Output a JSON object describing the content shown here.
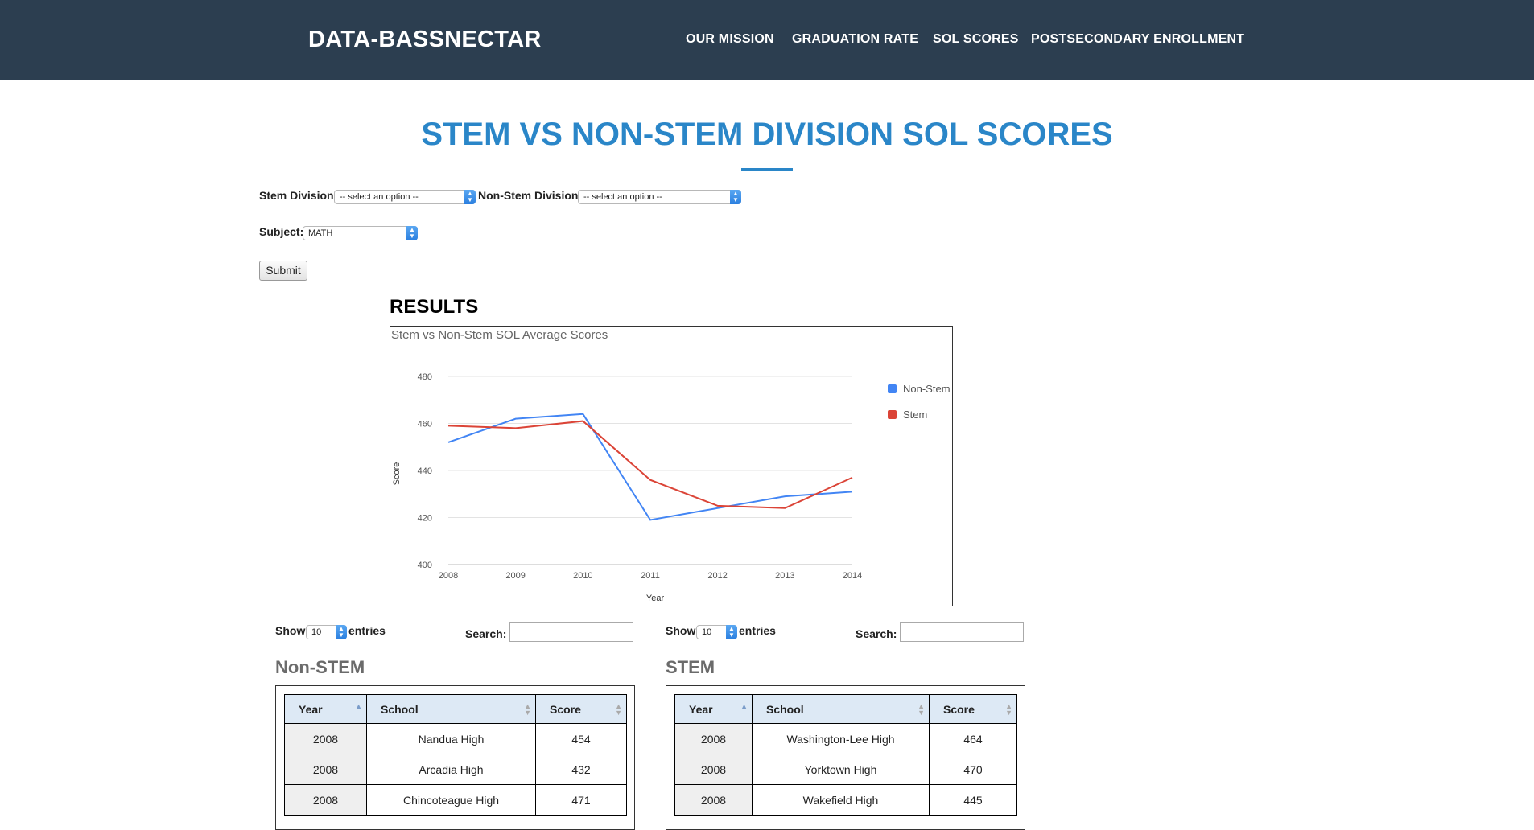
{
  "header": {
    "brand": "DATA-BASSNECTAR",
    "nav": [
      "OUR MISSION",
      "GRADUATION RATE",
      "SOL SCORES",
      "POSTSECONDARY ENROLLMENT"
    ]
  },
  "page_title": "STEM VS NON-STEM DIVISION SOL SCORES",
  "form": {
    "stem_label": "Stem Division:",
    "stem_value": "-- select an option --",
    "nonstem_label": "Non-Stem Division:",
    "nonstem_value": "-- select an option --",
    "subject_label": "Subject:",
    "subject_value": "MATH",
    "submit_label": "Submit"
  },
  "results_heading": "RESULTS",
  "chart_data": {
    "type": "line",
    "title": "Stem vs Non-Stem SOL Average Scores",
    "xlabel": "Year",
    "ylabel": "Score",
    "x": [
      2008,
      2009,
      2010,
      2011,
      2012,
      2013,
      2014
    ],
    "ylim": [
      400,
      480
    ],
    "yticks": [
      400,
      420,
      440,
      460,
      480
    ],
    "grid": true,
    "legend_position": "right",
    "series": [
      {
        "name": "Non-Stem",
        "color": "#4285f4",
        "values": [
          452,
          462,
          464,
          419,
          424,
          429,
          431
        ]
      },
      {
        "name": "Stem",
        "color": "#db4437",
        "values": [
          459,
          458,
          461,
          436,
          425,
          424,
          437
        ]
      }
    ]
  },
  "nonstem_table": {
    "show_label": "Show",
    "entries_value": "10",
    "entries_label": "entries",
    "search_label": "Search:",
    "title": "Non-STEM",
    "columns": [
      "Year",
      "School",
      "Score"
    ],
    "rows": [
      [
        "2008",
        "Nandua High",
        "454"
      ],
      [
        "2008",
        "Arcadia High",
        "432"
      ],
      [
        "2008",
        "Chincoteague High",
        "471"
      ]
    ]
  },
  "stem_table": {
    "show_label": "Show",
    "entries_value": "10",
    "entries_label": "entries",
    "search_label": "Search:",
    "title": "STEM",
    "columns": [
      "Year",
      "School",
      "Score"
    ],
    "rows": [
      [
        "2008",
        "Washington-Lee High",
        "464"
      ],
      [
        "2008",
        "Yorktown High",
        "470"
      ],
      [
        "2008",
        "Wakefield High",
        "445"
      ]
    ]
  },
  "colors": {
    "header_bg": "#2c3e50",
    "accent": "#2a86c8",
    "table_header_bg": "#dde9f5"
  }
}
